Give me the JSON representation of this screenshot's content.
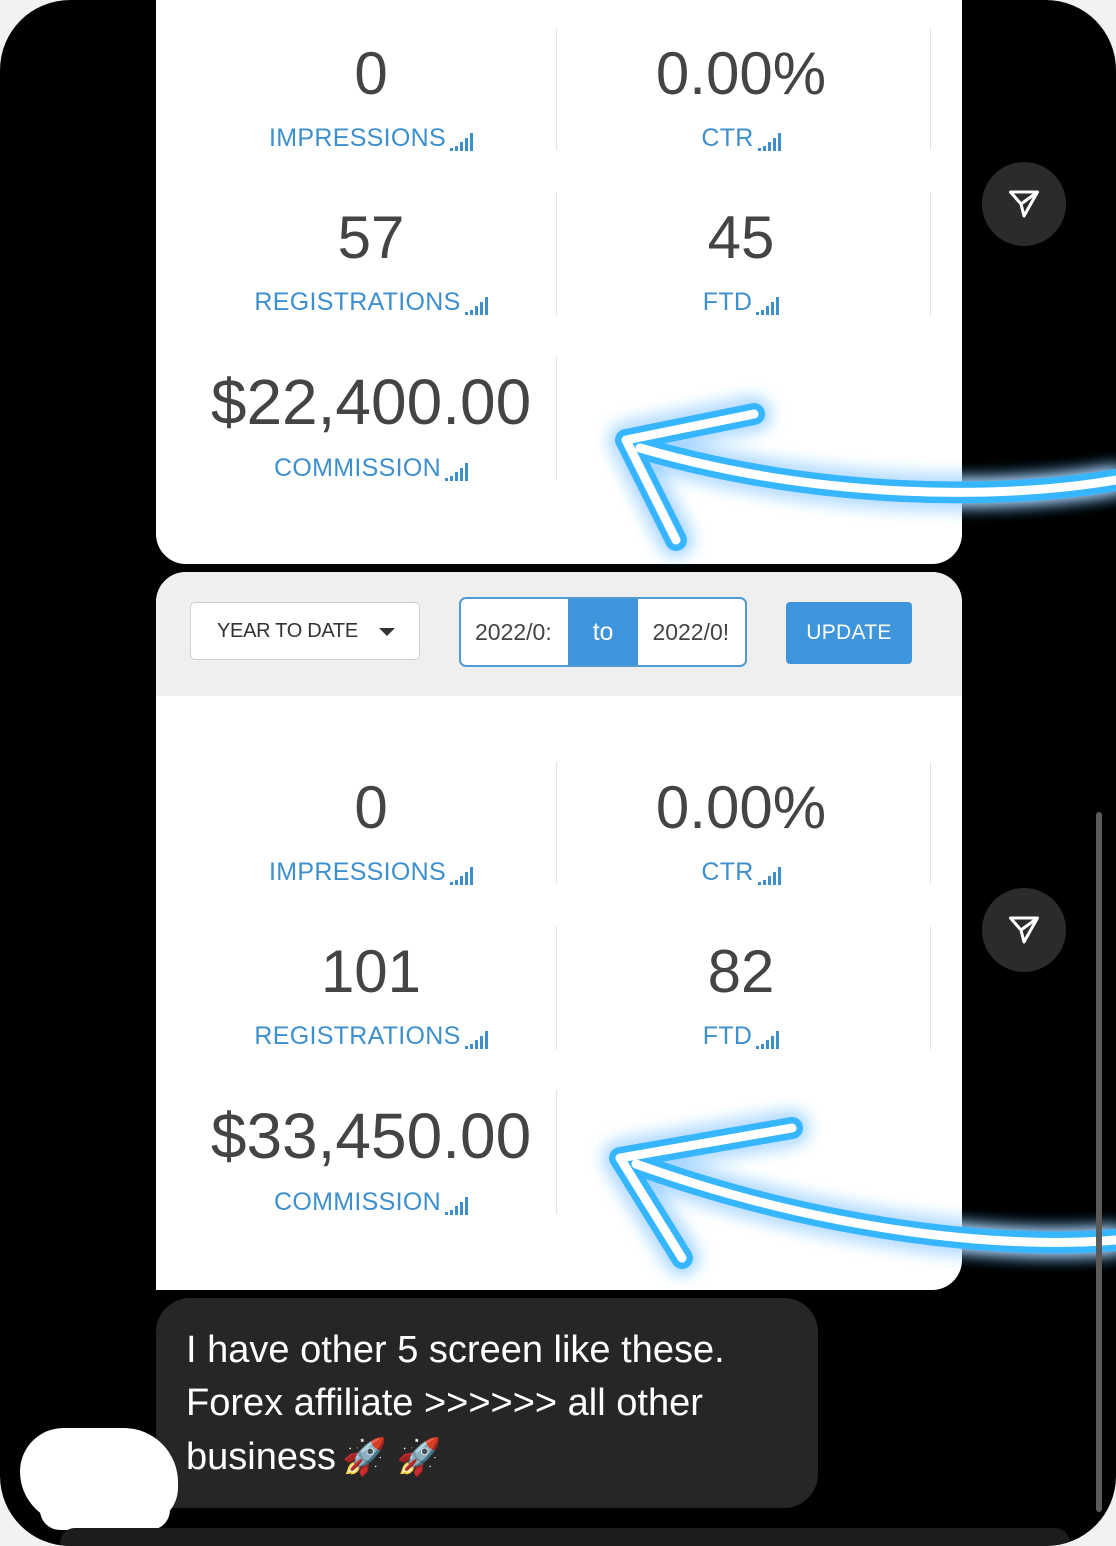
{
  "stats_top": {
    "impressions": {
      "value": "0",
      "label": "IMPRESSIONS"
    },
    "ctr": {
      "value": "0.00%",
      "label": "CTR"
    },
    "registrations": {
      "value": "57",
      "label": "REGISTRATIONS"
    },
    "ftd": {
      "value": "45",
      "label": "FTD"
    },
    "commission": {
      "value": "$22,400.00",
      "label": "COMMISSION"
    }
  },
  "filter": {
    "period": "YEAR TO DATE",
    "date_from": "2022/0:",
    "to_label": "to",
    "date_to": "2022/0!",
    "update_label": "UPDATE"
  },
  "stats_bottom": {
    "impressions": {
      "value": "0",
      "label": "IMPRESSIONS"
    },
    "ctr": {
      "value": "0.00%",
      "label": "CTR"
    },
    "registrations": {
      "value": "101",
      "label": "REGISTRATIONS"
    },
    "ftd": {
      "value": "82",
      "label": "FTD"
    },
    "commission": {
      "value": "$33,450.00",
      "label": "COMMISSION"
    }
  },
  "message": {
    "line1": "I have other 5 screen like these.",
    "line2": "Forex affiliate >>>>>> all other",
    "line3": "business",
    "emoji": "🚀 🚀"
  },
  "icons": {
    "share": "paper-plane-icon",
    "signal": "signal-bars-icon"
  },
  "colors": {
    "accent": "#3f95dc",
    "label": "#3d8fcd",
    "glow": "#35b6ff"
  }
}
